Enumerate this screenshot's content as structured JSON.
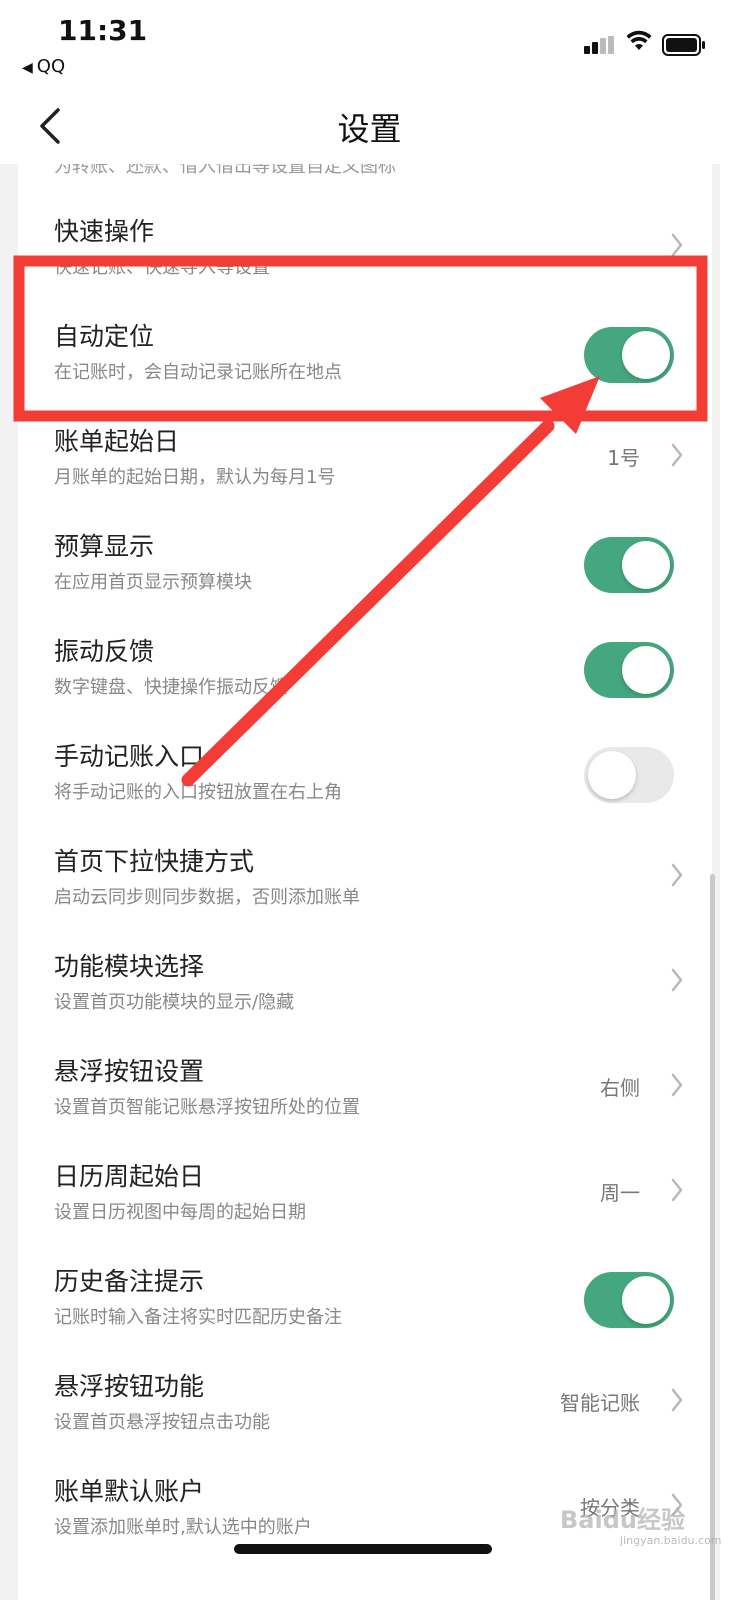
{
  "status_bar": {
    "time": "11:31",
    "back_app": "QQ"
  },
  "nav": {
    "title": "设置"
  },
  "partial_top_sub": "为转账、还款、借入借出等设置自定义图标",
  "rows": [
    {
      "title": "快速操作",
      "sub": "快速记账、快速导入等设置",
      "control": "chevron"
    },
    {
      "title": "自动定位",
      "sub": "在记账时，会自动记录记账所在地点",
      "control": "toggle",
      "toggle_on": true
    },
    {
      "title": "账单起始日",
      "sub": "月账单的起始日期，默认为每月1号",
      "control": "chevron",
      "value": "1号"
    },
    {
      "title": "预算显示",
      "sub": "在应用首页显示预算模块",
      "control": "toggle",
      "toggle_on": true
    },
    {
      "title": "振动反馈",
      "sub": "数字键盘、快捷操作振动反馈",
      "control": "toggle",
      "toggle_on": true
    },
    {
      "title": "手动记账入口",
      "sub": "将手动记账的入口按钮放置在右上角",
      "control": "toggle",
      "toggle_on": false
    },
    {
      "title": "首页下拉快捷方式",
      "sub": "启动云同步则同步数据，否则添加账单",
      "control": "chevron"
    },
    {
      "title": "功能模块选择",
      "sub": "设置首页功能模块的显示/隐藏",
      "control": "chevron"
    },
    {
      "title": "悬浮按钮设置",
      "sub": "设置首页智能记账悬浮按钮所处的位置",
      "control": "chevron",
      "value": "右侧"
    },
    {
      "title": "日历周起始日",
      "sub": "设置日历视图中每周的起始日期",
      "control": "chevron",
      "value": "周一"
    },
    {
      "title": "历史备注提示",
      "sub": "记账时输入备注将实时匹配历史备注",
      "control": "toggle",
      "toggle_on": true
    },
    {
      "title": "悬浮按钮功能",
      "sub": "设置首页悬浮按钮点击功能",
      "control": "chevron",
      "value": "智能记账"
    },
    {
      "title": "账单默认账户",
      "sub": "设置添加账单时,默认选中的账户",
      "control": "chevron",
      "value": "按分类"
    }
  ],
  "colors": {
    "toggle_on": "#45a77f",
    "toggle_off": "#e9e9ea",
    "annotation": "#f43c37"
  },
  "watermark": {
    "main": "Baidu经验",
    "sub": "jingyan.baidu.com"
  }
}
